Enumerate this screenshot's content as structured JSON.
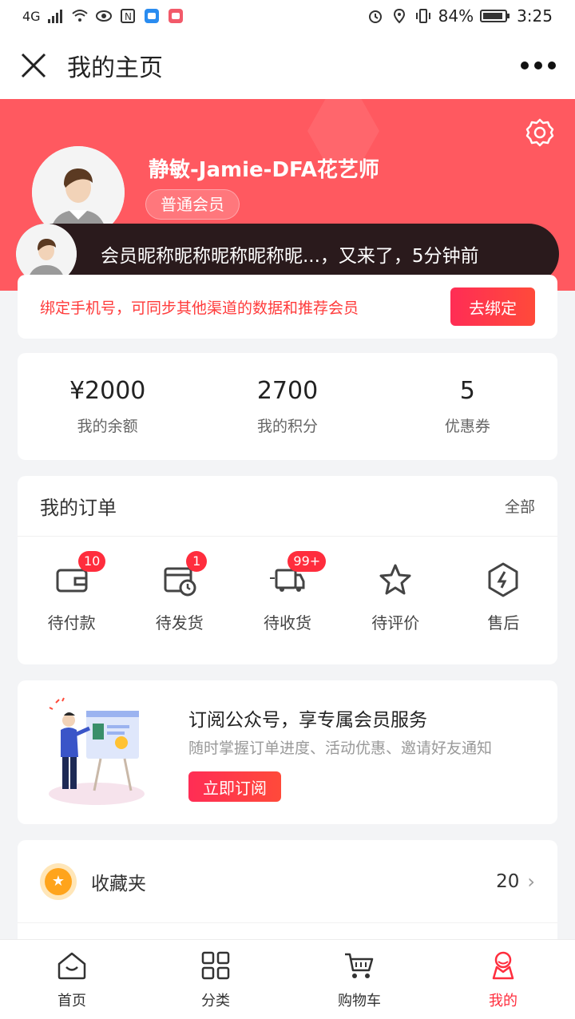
{
  "status_bar": {
    "network": "4G",
    "battery": "84%",
    "time": "3:25"
  },
  "nav": {
    "title": "我的主页"
  },
  "profile": {
    "name": "静敏-Jamie-DFA花艺师",
    "member_level": "普通会员"
  },
  "toast": {
    "text": "会员昵称昵称昵称昵称昵...，又来了，5分钟前"
  },
  "bind": {
    "text": "绑定手机号，可同步其他渠道的数据和推荐会员",
    "button": "去绑定"
  },
  "stats": [
    {
      "value": "¥2000",
      "label": "我的余额"
    },
    {
      "value": "2700",
      "label": "我的积分"
    },
    {
      "value": "5",
      "label": "优惠券"
    }
  ],
  "orders": {
    "title": "我的订单",
    "all": "全部",
    "items": [
      {
        "label": "待付款",
        "badge": "10"
      },
      {
        "label": "待发货",
        "badge": "1"
      },
      {
        "label": "待收货",
        "badge": "99+"
      },
      {
        "label": "待评价",
        "badge": ""
      },
      {
        "label": "售后",
        "badge": ""
      }
    ]
  },
  "subscribe": {
    "title": "订阅公众号，享专属会员服务",
    "desc": "随时掌握订单进度、活动优惠、邀请好友通知",
    "button": "立即订阅"
  },
  "favorites": {
    "label": "收藏夹",
    "count": "20"
  },
  "tabbar": [
    {
      "label": "首页",
      "icon": "home-icon",
      "active": false
    },
    {
      "label": "分类",
      "icon": "grid-icon",
      "active": false
    },
    {
      "label": "购物车",
      "icon": "cart-icon",
      "active": false
    },
    {
      "label": "我的",
      "icon": "user-icon",
      "active": true
    }
  ],
  "colors": {
    "brand": "#ff5960",
    "accent": "#ff2d3d"
  }
}
